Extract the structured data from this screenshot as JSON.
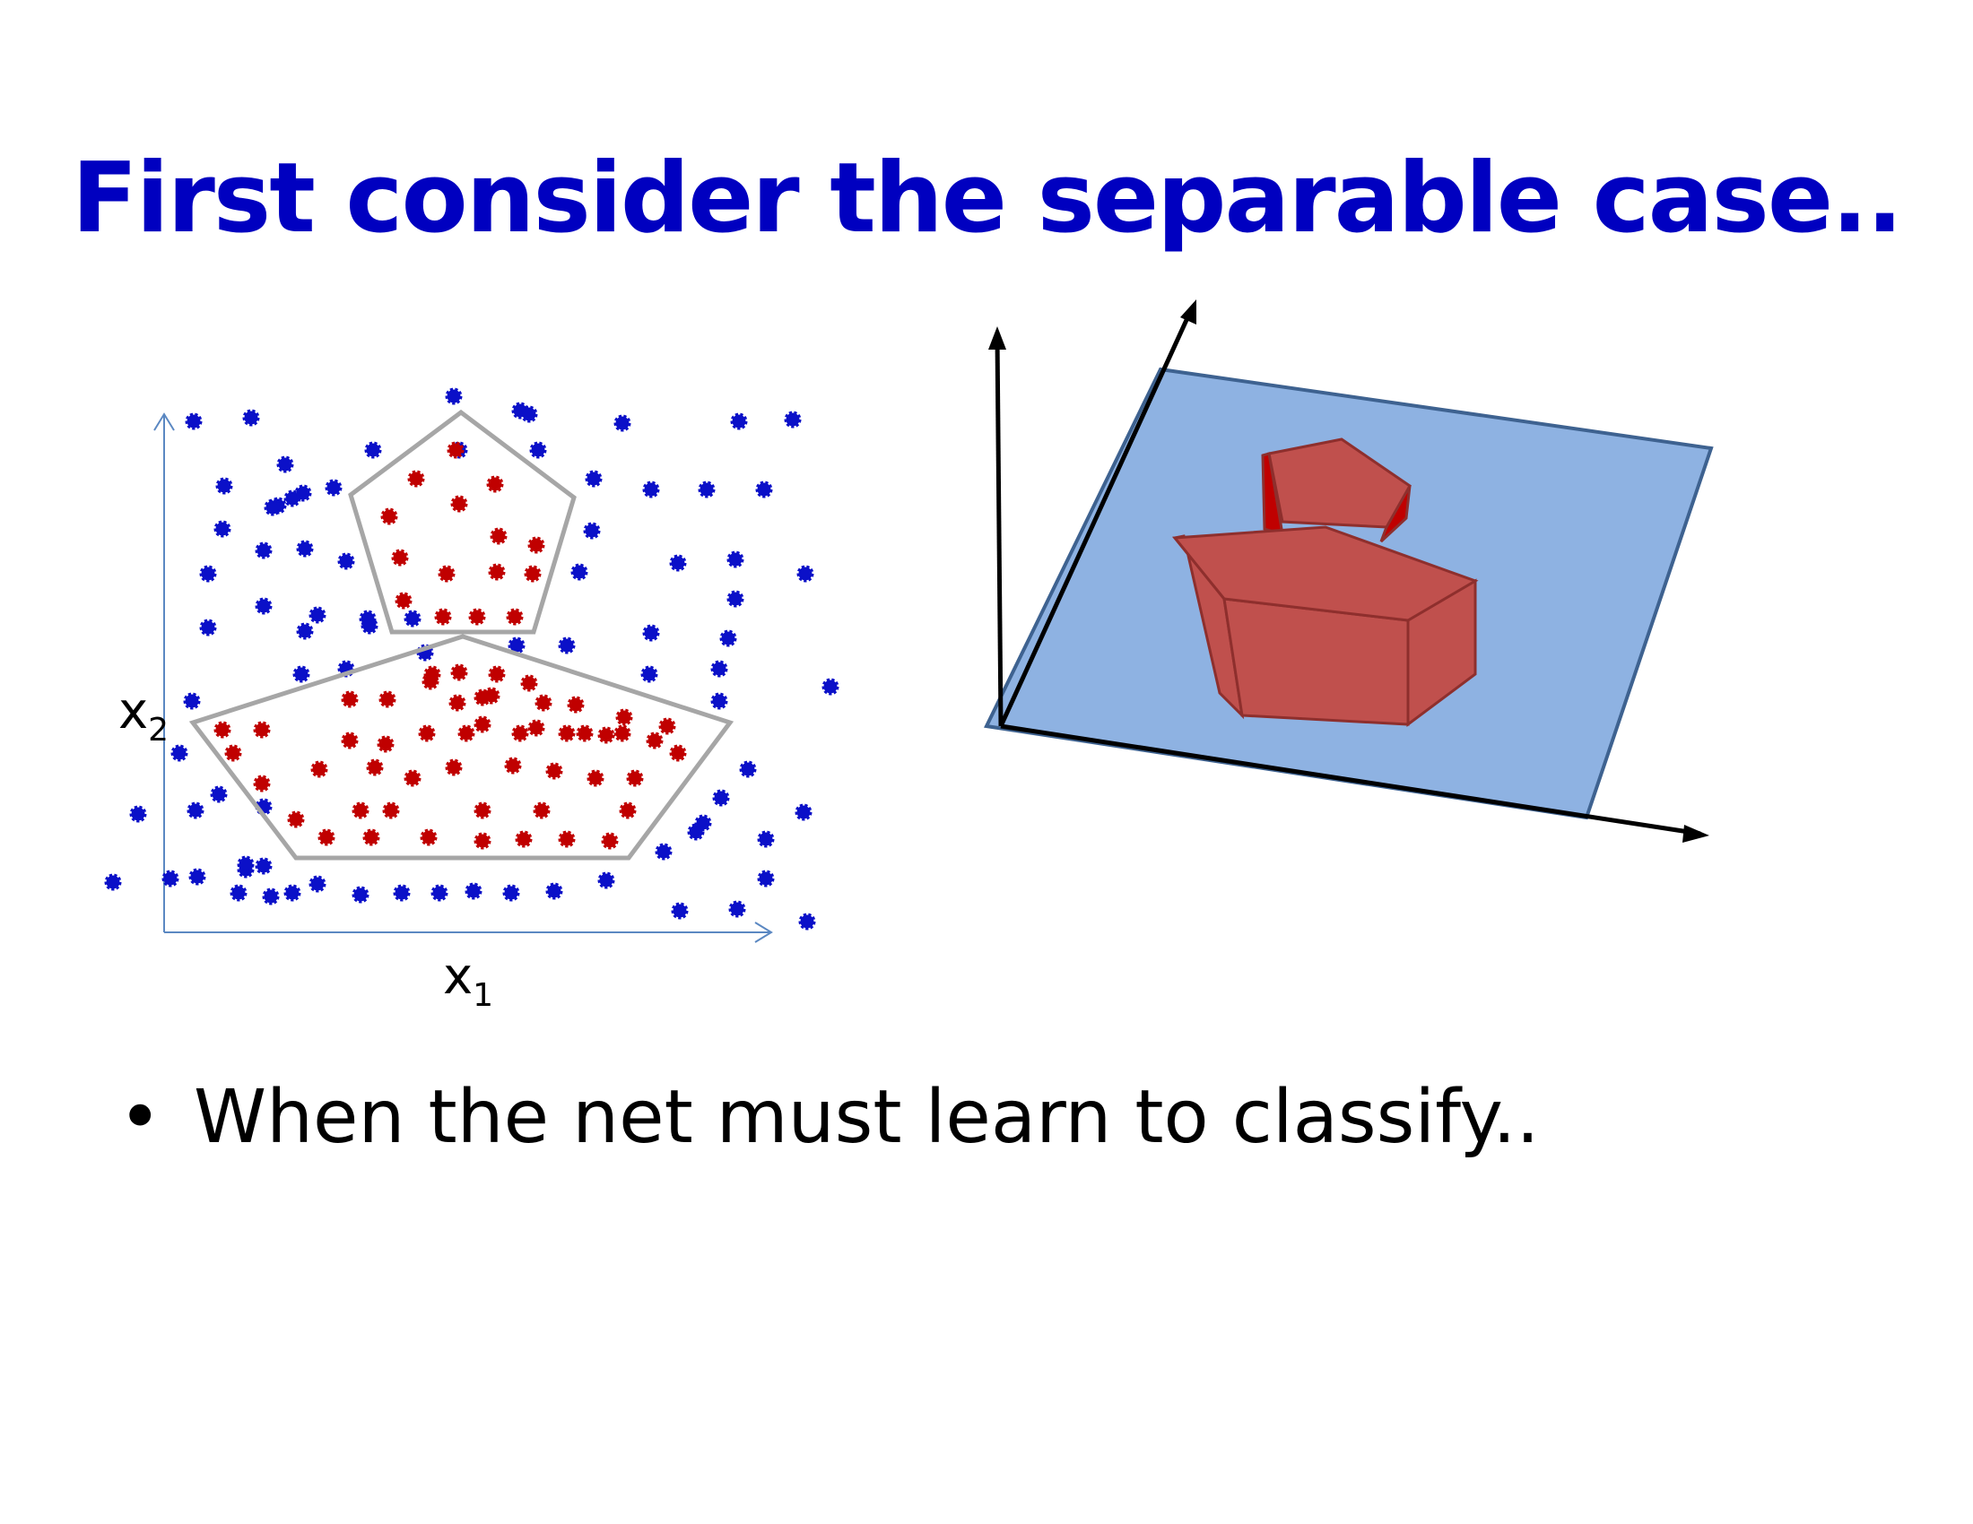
{
  "title": "First consider the separable case..",
  "axes": {
    "x_label": "x",
    "x_sub": "1",
    "y_label": "x",
    "y_sub": "2"
  },
  "bullets": [
    {
      "symbol": "•",
      "text": "When the net must learn to classify.."
    }
  ],
  "colors": {
    "title": "#0000c0",
    "class_outside": "#0b10c8",
    "class_inside": "#c00000",
    "boundary": "#a6a6a6",
    "axis": "#5b88c2",
    "plane_fill": "#8eb2e2",
    "plane_edge": "#3e6290",
    "solid_fill": "#c0504d",
    "solid_edge": "#8e2f2d"
  },
  "diagram": {
    "left_panel": "2D scatter of blue points surrounding two red clusters, each enclosed by a gray pentagon boundary",
    "right_panel": "3D axes with a blue plane and two red pentagonal prisms standing on the plane"
  }
}
